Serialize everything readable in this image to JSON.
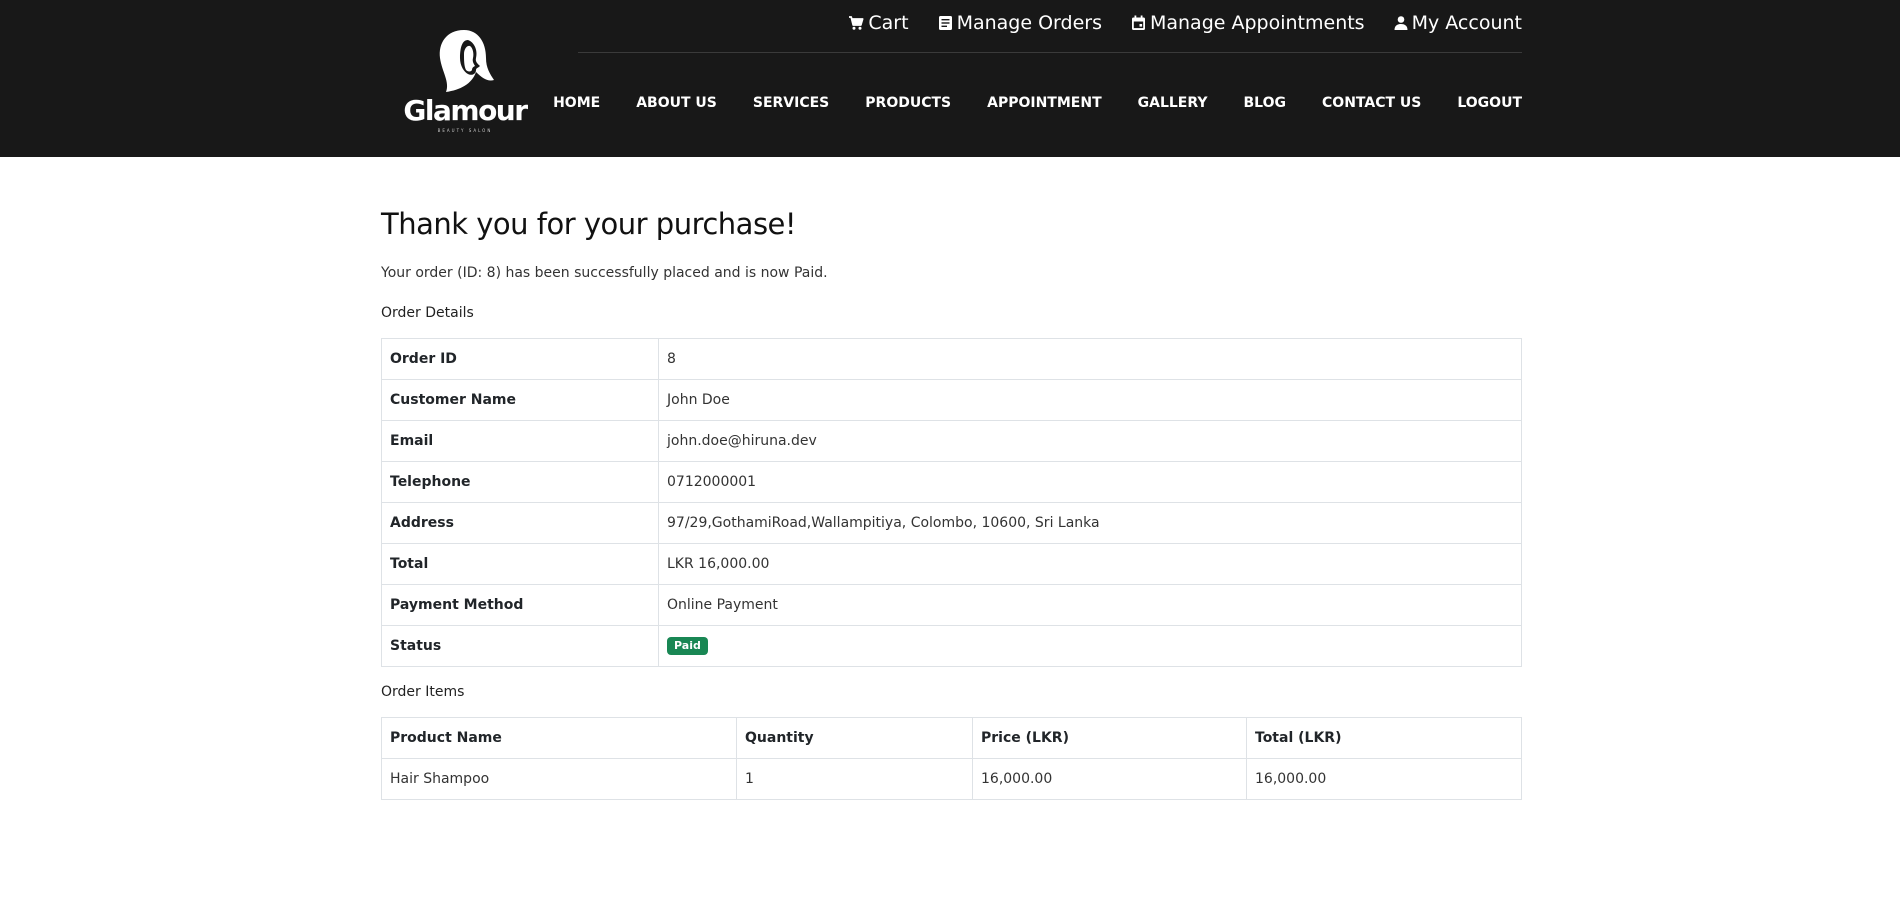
{
  "brand": {
    "name": "Glamour",
    "tagline": "BEAUTY SALON"
  },
  "top_links": [
    {
      "icon": "cart-icon",
      "label": "Cart"
    },
    {
      "icon": "orders-icon",
      "label": "Manage Orders"
    },
    {
      "icon": "calendar-icon",
      "label": "Manage Appointments"
    },
    {
      "icon": "user-icon",
      "label": "My Account"
    }
  ],
  "nav": [
    "HOME",
    "ABOUT US",
    "SERVICES",
    "PRODUCTS",
    "APPOINTMENT",
    "GALLERY",
    "BLOG",
    "CONTACT US",
    "LOGOUT"
  ],
  "main": {
    "title": "Thank you for your purchase!",
    "confirmation": "Your order (ID: 8) has been successfully placed and is now Paid.",
    "details_label": "Order Details",
    "items_label": "Order Items"
  },
  "order_details": [
    {
      "key": "Order ID",
      "value": "8"
    },
    {
      "key": "Customer Name",
      "value": "John Doe"
    },
    {
      "key": "Email",
      "value": "john.doe@hiruna.dev"
    },
    {
      "key": "Telephone",
      "value": "0712000001"
    },
    {
      "key": "Address",
      "value": "97/29,GothamiRoad,Wallampitiya, Colombo, 10600, Sri Lanka"
    },
    {
      "key": "Total",
      "value": "LKR 16,000.00"
    },
    {
      "key": "Payment Method",
      "value": "Online Payment"
    },
    {
      "key": "Status",
      "value": "Paid"
    }
  ],
  "status_color": "#198754",
  "order_items": {
    "headers": [
      "Product Name",
      "Quantity",
      "Price (LKR)",
      "Total (LKR)"
    ],
    "rows": [
      [
        "Hair Shampoo",
        "1",
        "16,000.00",
        "16,000.00"
      ]
    ]
  }
}
